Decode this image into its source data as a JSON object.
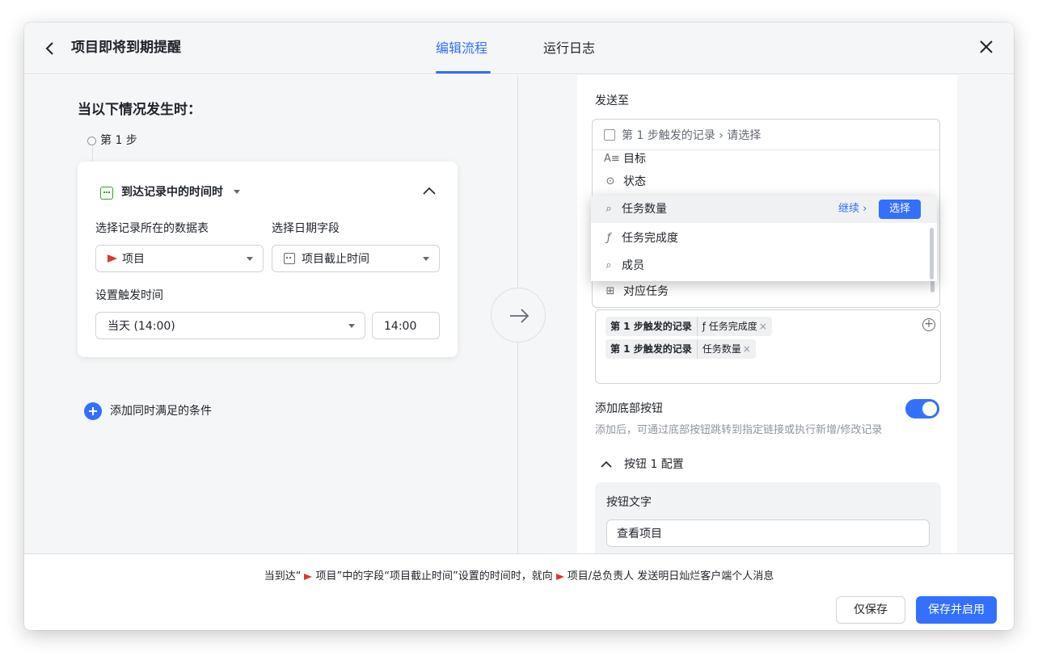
{
  "header": {
    "title": "项目即将到期提醒",
    "tabs": [
      {
        "label": "编辑流程",
        "active": true
      },
      {
        "label": "运行日志",
        "active": false
      }
    ]
  },
  "left": {
    "when_title": "当以下情况发生时：",
    "step_label": "第 1 步",
    "trigger": {
      "label": "到达记录中的时间时",
      "table_label": "选择记录所在的数据表",
      "table_value": "项目",
      "date_label": "选择日期字段",
      "date_value": "项目截止时间",
      "time_label": "设置触发时间",
      "time_option": "当天 (14:00)",
      "time_value": "14:00"
    },
    "add_condition": "添加同时满足的条件"
  },
  "right": {
    "send_to": "发送至",
    "record_path": "第 1 步触发的记录  ›  请选择",
    "options_behind": [
      {
        "icon": "text-icon",
        "label": "目标"
      },
      {
        "icon": "status-icon",
        "label": "状态"
      },
      {
        "icon": "link-icon",
        "label": "对应任务"
      }
    ],
    "dropdown": {
      "options": [
        {
          "icon": "lookup-icon",
          "label": "任务数量",
          "highlighted": true
        },
        {
          "icon": "formula-icon",
          "label": "任务完成度",
          "highlighted": false
        },
        {
          "icon": "lookup-icon",
          "label": "成员",
          "highlighted": false
        }
      ],
      "continue_label": "继续 ›",
      "select_label": "选择"
    },
    "chips": [
      {
        "source": "第 1 步触发的记录",
        "field": "ƒ 任务完成度"
      },
      {
        "source": "第 1 步触发的记录",
        "field": "任务数量"
      }
    ],
    "add_bottom_button": {
      "title": "添加底部按钮",
      "enabled": true,
      "desc": "添加后，可通过底部按钮跳转到指定链接或执行新增/修改记录"
    },
    "button_config": {
      "title": "按钮 1 配置",
      "text_label": "按钮文字",
      "text_value": "查看项目"
    }
  },
  "footer": {
    "note_prefix": "当到达“",
    "note_table": "项目",
    "note_middle": "”中的字段“项目截止时间”设置的时间时，就向",
    "note_target": "项目/总负责人",
    "note_suffix": " 发送明日灿烂客户端个人消息",
    "save_label": "仅保存",
    "save_enable_label": "保存并启用"
  },
  "colors": {
    "accent": "#3370ff",
    "flag": "#d83931",
    "trigger_icon": "#2ea121"
  }
}
